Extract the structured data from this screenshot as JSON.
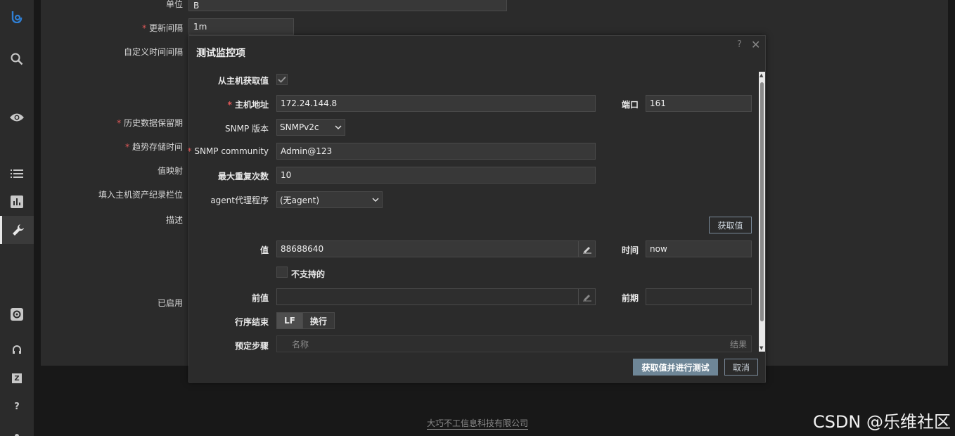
{
  "nav": {
    "logo": "zabbix-logo",
    "items": [
      "search-icon",
      "monitoring-eye-icon",
      "inventory-list-icon",
      "reports-chart-icon",
      "configuration-wrench-icon",
      "administration-gear-icon",
      "support-headset-icon",
      "share-icon",
      "help-icon"
    ],
    "help_label": "?",
    "share_label": "Z"
  },
  "bg_form": {
    "unit_label": "单位",
    "unit_value": "B",
    "update_interval_label": "更新间隔",
    "update_interval_value": "1m",
    "custom_interval_label": "自定义时间间隔",
    "history_label": "历史数据保留期",
    "trends_label": "趋势存储时间",
    "valuemap_label": "值映射",
    "inventory_label": "填入主机资产纪录栏位",
    "description_label": "描述",
    "enabled_label": "已启用"
  },
  "modal": {
    "title": "测试监控项",
    "help": "?",
    "close": "✕",
    "get_from_host_label": "从主机获取值",
    "host_address_label": "主机地址",
    "host_address_value": "172.24.144.8",
    "port_label": "端口",
    "port_value": "161",
    "snmp_version_label": "SNMP 版本",
    "snmp_version_value": "SNMPv2c",
    "snmp_community_label": "SNMP community",
    "snmp_community_value": "Admin@123",
    "max_repetitions_label": "最大重复次数",
    "max_repetitions_value": "10",
    "agent_label": "agent代理程序",
    "agent_value": "(无agent)",
    "get_value_button": "获取值",
    "value_label": "值",
    "value_value": "88688640",
    "time_label": "时间",
    "time_value": "now",
    "not_supported_label": "不支持的",
    "prev_value_label": "前值",
    "prev_value_value": "",
    "prev_time_label": "前期",
    "prev_time_value": "",
    "eol_label": "行序结束",
    "eol_options": [
      "LF",
      "换行"
    ],
    "preprocessing_label": "预定步骤",
    "steps_name_header": "名称",
    "steps_result_header": "结果",
    "get_and_test_button": "获取值并进行测试",
    "cancel_button": "取消"
  },
  "footer": {
    "company": "大巧不工信息科技有限公司"
  },
  "watermark": "CSDN @乐维社区",
  "colors": {
    "accent_button": "#6e8697",
    "required_star": "#e45959",
    "panel": "#2b2b2b",
    "input": "#383838"
  }
}
